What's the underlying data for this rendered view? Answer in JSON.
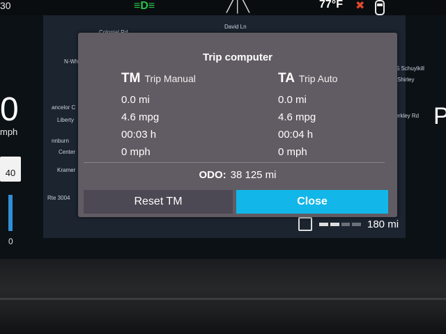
{
  "status_bar": {
    "left_number": "30",
    "headlight_icon": "headlight-icon",
    "road_icon": "road-icon",
    "temperature": "77°F",
    "seatbelt_icon": "seatbelt-warning-icon",
    "car_icon": "car-top-view-icon"
  },
  "map": {
    "labels": [
      "N-Whi",
      "ancelor C",
      "Liberty",
      "nnburn",
      "Center",
      "Kramer",
      "Rte 3004",
      "S Schuylkill",
      "Shirley",
      "Berkley Rd",
      "David Ln",
      "Colonial Rd"
    ]
  },
  "left_gauge": {
    "speed": "0",
    "unit": "mph",
    "limit": "40",
    "scale_zero": "0"
  },
  "right_gauge": {
    "gear": "P"
  },
  "fuel": {
    "range": "180 mi",
    "level_fraction": 0.5
  },
  "dialog": {
    "title": "Trip computer",
    "trip_manual": {
      "abbr": "TM",
      "name": "Trip Manual",
      "distance": "0.0 mi",
      "economy": "4.6 mpg",
      "time": "00:03 h",
      "speed": "0 mph"
    },
    "trip_auto": {
      "abbr": "TA",
      "name": "Trip Auto",
      "distance": "0.0 mi",
      "economy": "4.6 mpg",
      "time": "00:04 h",
      "speed": "0 mph"
    },
    "odo_label": "ODO:",
    "odo_value": "38 125 mi",
    "reset_label": "Reset TM",
    "close_label": "Close",
    "accent_color": "#12b6e8"
  }
}
